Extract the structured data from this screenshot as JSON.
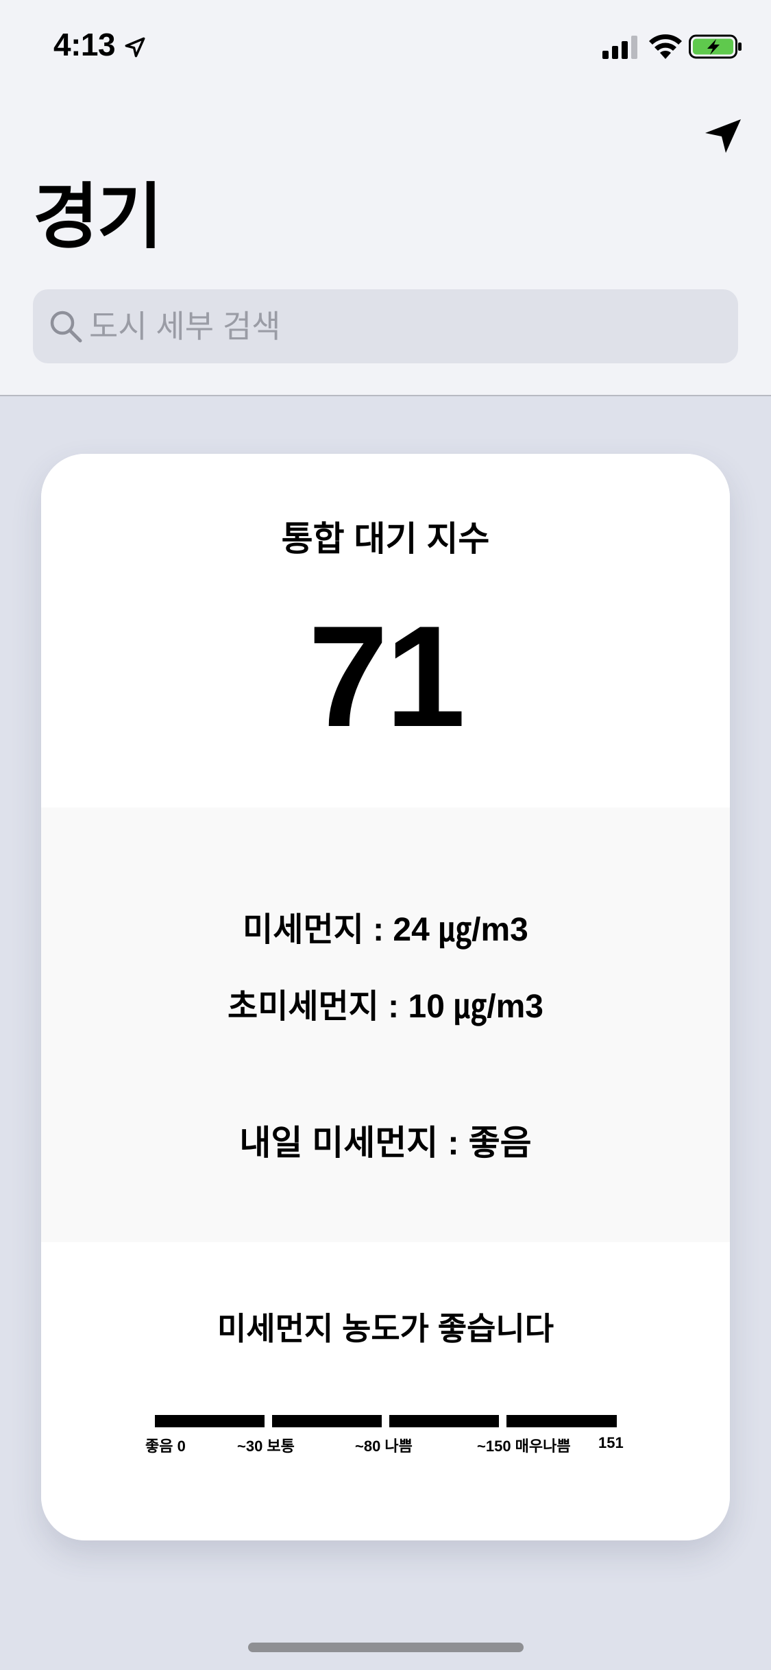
{
  "status_bar": {
    "time": "4:13",
    "location_icon": "location-arrow-icon",
    "signal_icon": "cellular-signal-icon",
    "wifi_icon": "wifi-icon",
    "battery_icon": "battery-charging-icon",
    "battery_color": "#5fc94d"
  },
  "header": {
    "title": "경기",
    "location_button_icon": "location-arrow-icon"
  },
  "search": {
    "placeholder": "도시 세부 검색",
    "value": "",
    "icon": "search-icon"
  },
  "card": {
    "aqi_label": "통합 대기 지수",
    "aqi_value": "71",
    "pm10": "미세먼지 : 24 ㎍/m3",
    "pm25": "초미세먼지 : 10 ㎍/m3",
    "tomorrow": "내일 미세먼지 : 좋음",
    "status_message": "미세먼지 농도가 좋습니다",
    "scale": {
      "labels": [
        "좋음 0",
        "~30 보통",
        "~80 나쁨",
        "~150 매우나쁨",
        "151"
      ],
      "bar_color": "#000000"
    }
  },
  "colors": {
    "background": "#dee1eb",
    "header_background": "#f2f3f7",
    "card_background": "#ffffff",
    "card_mid_background": "#f9f9f9"
  }
}
